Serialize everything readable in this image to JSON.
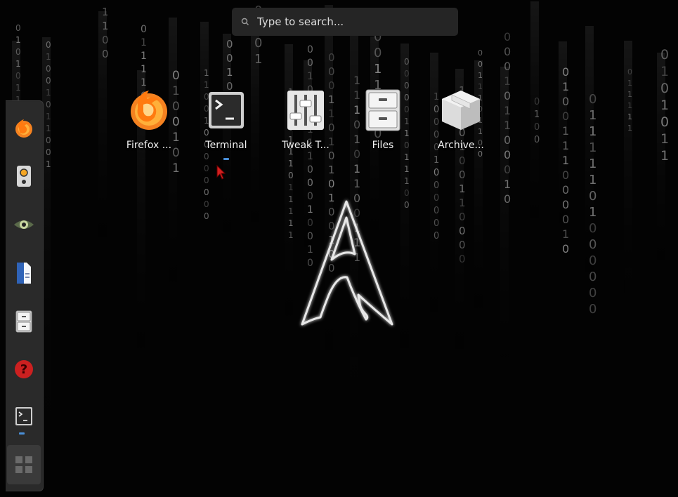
{
  "search": {
    "placeholder": "Type to search..."
  },
  "apps": [
    {
      "label": "Firefox ...",
      "icon": "firefox-icon"
    },
    {
      "label": "Terminal",
      "icon": "terminal-icon",
      "running": true
    },
    {
      "label": "Tweak T...",
      "icon": "tweak-tool-icon"
    },
    {
      "label": "Files",
      "icon": "files-icon"
    },
    {
      "label": "Archive...",
      "icon": "archive-manager-icon"
    }
  ],
  "dock": {
    "items": [
      {
        "name": "firefox",
        "icon": "firefox-icon"
      },
      {
        "name": "speaker",
        "icon": "speaker-icon"
      },
      {
        "name": "eye-of-gnome",
        "icon": "image-viewer-icon"
      },
      {
        "name": "text-editor",
        "icon": "document-icon"
      },
      {
        "name": "files",
        "icon": "files-icon"
      },
      {
        "name": "help",
        "icon": "help-icon"
      },
      {
        "name": "terminal",
        "icon": "terminal-icon",
        "running": true
      }
    ],
    "show_apps_icon": "app-grid-icon"
  },
  "colors": {
    "background": "#030303",
    "digits": "#8a8a8a",
    "search_bg": "#252525",
    "dock_bg": "#2a2a2a",
    "running_indicator": "#4a90d9",
    "firefox_orange": "#f58220"
  }
}
